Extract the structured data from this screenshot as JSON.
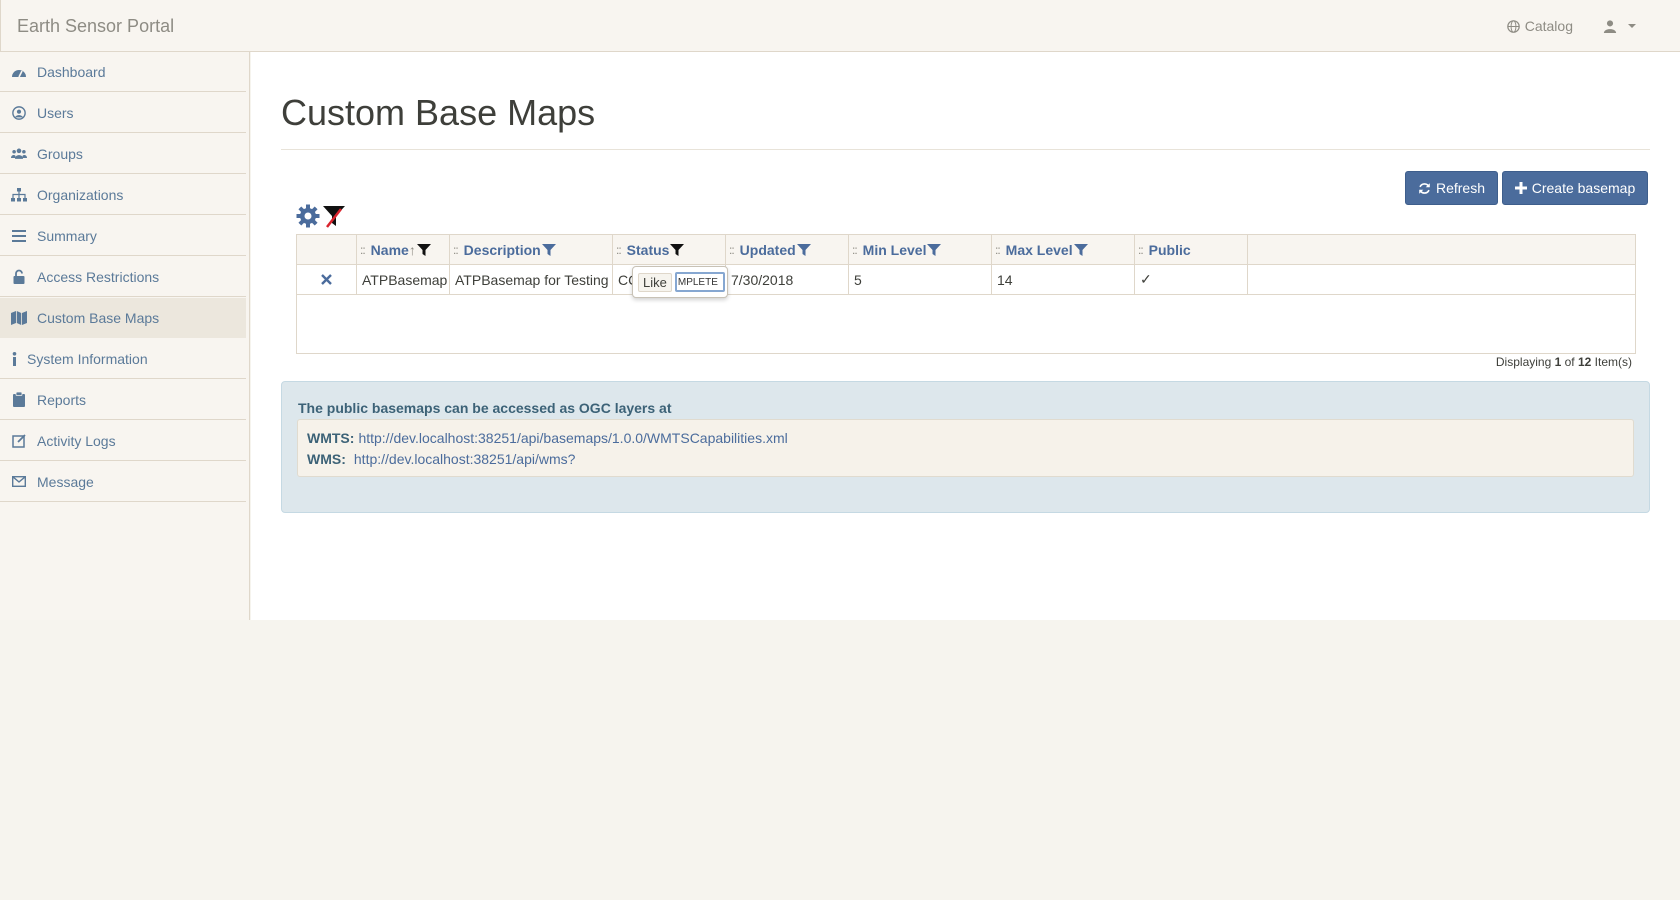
{
  "navbar": {
    "brand": "Earth Sensor Portal",
    "catalog_label": "Catalog"
  },
  "sidebar": {
    "items": [
      {
        "label": "Dashboard",
        "icon": "dashboard-icon"
      },
      {
        "label": "Users",
        "icon": "user-circle-icon"
      },
      {
        "label": "Groups",
        "icon": "users-icon"
      },
      {
        "label": "Organizations",
        "icon": "sitemap-icon"
      },
      {
        "label": "Summary",
        "icon": "list-icon"
      },
      {
        "label": "Access Restrictions",
        "icon": "unlock-icon"
      },
      {
        "label": "Custom Base Maps",
        "icon": "map-icon",
        "active": true
      },
      {
        "label": "System Information",
        "icon": "info-icon"
      },
      {
        "label": "Reports",
        "icon": "clipboard-icon"
      },
      {
        "label": "Activity Logs",
        "icon": "edit-icon"
      },
      {
        "label": "Message",
        "icon": "envelope-icon"
      }
    ]
  },
  "main": {
    "title": "Custom Base Maps",
    "refresh_label": "Refresh",
    "create_label": "Create basemap"
  },
  "grid": {
    "columns": [
      "Name",
      "Description",
      "Status",
      "Updated",
      "Min Level",
      "Max Level",
      "Public"
    ],
    "sort_indicator": "↑",
    "rows": [
      {
        "name": "ATPBasemap",
        "description": "ATPBasemap for Testing",
        "status": "CC",
        "updated": "7/30/2018",
        "min_level": "5",
        "max_level": "14",
        "public": "✓"
      }
    ],
    "filter_popup": {
      "label": "Like",
      "value": "MPLETE"
    },
    "display_prefix": "Displaying ",
    "display_shown": "1",
    "display_mid": " of ",
    "display_total": "12",
    "display_suffix": " Item(s)"
  },
  "info": {
    "title": "The public basemaps can be accessed as OGC layers at",
    "wmts_label": "WMTS:",
    "wmts_url": "http://dev.localhost:38251/api/basemaps/1.0.0/WMTSCapabilities.xml",
    "wms_label": "WMS:",
    "wms_url": "http://dev.localhost:38251/api/wms?"
  },
  "colors": {
    "accent": "#4b6c9c",
    "link": "#5b7a99",
    "sidebar_bg": "#f8f5f0",
    "info_bg": "#dde7ec"
  }
}
